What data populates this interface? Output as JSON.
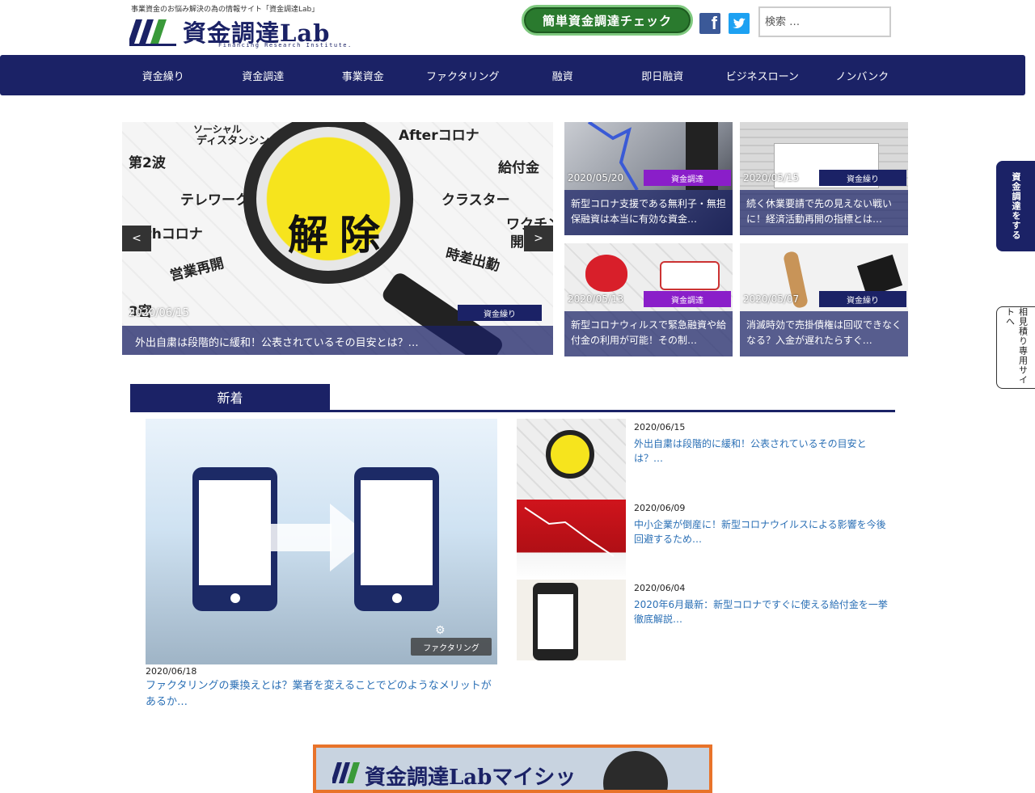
{
  "header": {
    "tagline": "事業資金のお悩み解決の為の情報サイト「資金調達Lab」",
    "logo_text": "資金調達Lab",
    "logo_sub": "Financing Research Institute.",
    "check_button": "簡単資金調達チェック",
    "facebook_icon": "facebook-icon",
    "twitter_icon": "twitter-icon",
    "search_placeholder": "検索 …"
  },
  "nav": {
    "items": [
      {
        "label": "資金繰り"
      },
      {
        "label": "資金調達"
      },
      {
        "label": "事業資金"
      },
      {
        "label": "ファクタリング"
      },
      {
        "label": "融資"
      },
      {
        "label": "即日融資"
      },
      {
        "label": "ビジネスローン"
      },
      {
        "label": "ノンバンク"
      }
    ]
  },
  "slider": {
    "words": [
      "ソーシャル",
      "ディスタンシング",
      "第2波",
      "Afterコロナ",
      "給付金",
      "テレワーク",
      "クラスター",
      "Withコロナ",
      "ワクチン",
      "開",
      "営業再開",
      "時差出勤",
      "3密",
      "解除"
    ],
    "prev": "<",
    "next": ">",
    "date": "2020/06/15",
    "category": "資金繰り",
    "caption": "外出自粛は段階的に緩和！公表されているその目安とは？…"
  },
  "cards": [
    {
      "date": "2020/05/20",
      "category": "資金調達",
      "category_color": "#8a1ec9",
      "caption": "新型コロナ支援である無利子・無担保融資は本当に有効な資金…"
    },
    {
      "date": "2020/05/15",
      "category": "資金繰り",
      "category_color": "#1b2266",
      "caption": "続く休業要請で先の見えない戦いに！経済活動再開の指標とは…"
    },
    {
      "date": "2020/05/13",
      "category": "資金調達",
      "category_color": "#8a1ec9",
      "caption": "新型コロナウィルスで緊急融資や給付金の利用が可能！その制…"
    },
    {
      "date": "2020/05/07",
      "category": "資金繰り",
      "category_color": "#1b2266",
      "caption": "消滅時効で売掛債権は回収できなくなる？入金が遅れたらすぐ…"
    }
  ],
  "side_tabs": {
    "a": "資金調達をする",
    "b": "相見積り専用サイトへ"
  },
  "new_section": {
    "heading": "新着",
    "feature": {
      "category": "ファクタリング",
      "date": "2020/06/18",
      "title": "ファクタリングの乗換えとは？業者を変えることでどのようなメリットがあるか…"
    },
    "list": [
      {
        "date": "2020/06/15",
        "title": "外出自粛は段階的に緩和！公表されているその目安とは？…"
      },
      {
        "date": "2020/06/09",
        "title": "中小企業が倒産に！新型コロナウイルスによる影響を今後回避するため…"
      },
      {
        "date": "2020/06/04",
        "title": "2020年6月最新：新型コロナですぐに使える給付金を一挙徹底解説…"
      }
    ]
  },
  "banner": {
    "text": "資金調達Labマイシッ"
  },
  "colors": {
    "navy": "#1b2266",
    "purple": "#8a1ec9",
    "green": "#2a7a2e",
    "link": "#2a6fb5",
    "orange": "#e8732a"
  }
}
